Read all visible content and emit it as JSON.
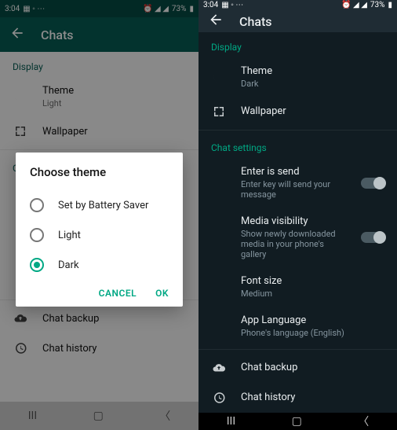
{
  "status": {
    "time": "3:04",
    "battery": "73%"
  },
  "app_title": "Chats",
  "sections": {
    "display": "Display",
    "chat_settings": "Chat settings"
  },
  "theme_label": "Theme",
  "theme_left": "Light",
  "theme_right": "Dark",
  "wallpaper": "Wallpaper",
  "enter_is_send": {
    "title": "Enter is send",
    "sub": "Enter key will send your message"
  },
  "media_visibility": {
    "title": "Media visibility",
    "sub": "Show newly downloaded media in your phone's gallery"
  },
  "font_size": {
    "title": "Font size",
    "sub": "Medium"
  },
  "app_language": {
    "title": "App Language",
    "sub": "Phone's language (English)"
  },
  "chat_backup": "Chat backup",
  "chat_history": "Chat history",
  "dialog": {
    "title": "Choose theme",
    "opt1": "Set by Battery Saver",
    "opt2": "Light",
    "opt3": "Dark",
    "cancel": "CANCEL",
    "ok": "OK"
  }
}
